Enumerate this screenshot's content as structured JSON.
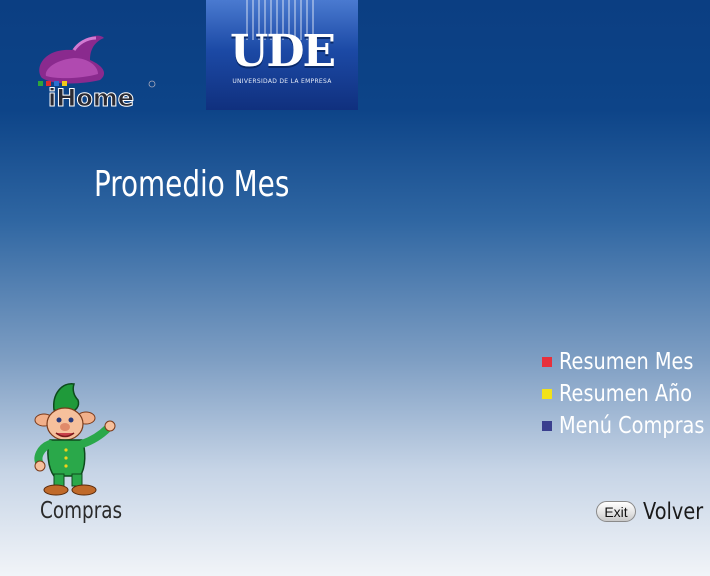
{
  "header": {
    "ihome_logo": {
      "text": "iHome",
      "icon": "ihome-hat-logo"
    },
    "ude_logo": {
      "text": "UDE",
      "subtitle": "UNIVERSIDAD DE LA EMPRESA"
    }
  },
  "main": {
    "title": "Promedio Mes"
  },
  "menu": {
    "items": [
      {
        "label": "Resumen Mes",
        "color": "#e8303c"
      },
      {
        "label": "Resumen Año",
        "color": "#f2e21a"
      },
      {
        "label": "Menú Compras",
        "color": "#3a3f8e"
      }
    ]
  },
  "footer": {
    "mascot_icon": "dwarf-mascot-icon",
    "compras_label": "Compras",
    "exit_label": "Exit",
    "volver_label": "Volver"
  }
}
